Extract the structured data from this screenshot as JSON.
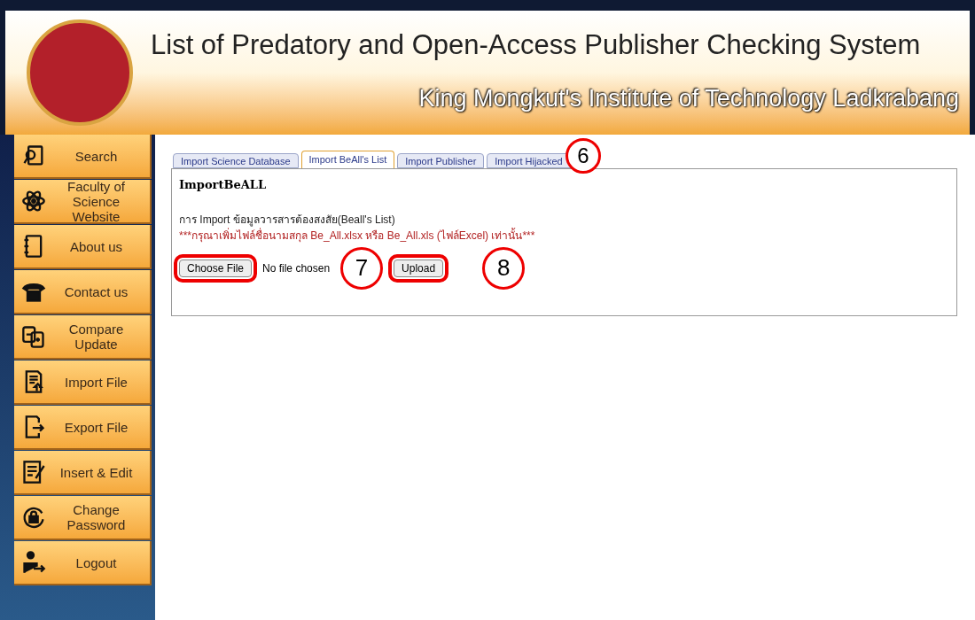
{
  "header": {
    "title": "List of Predatory and Open-Access Publisher Checking System",
    "subtitle": "King Mongkut's Institute of Technology Ladkrabang"
  },
  "sidebar": {
    "items": [
      {
        "label": "Search",
        "kind": "search"
      },
      {
        "label": "Faculty of Science Website",
        "kind": "atom"
      },
      {
        "label": "About us",
        "kind": "notebook"
      },
      {
        "label": "Contact us",
        "kind": "phone"
      },
      {
        "label": "Compare Update",
        "kind": "compare"
      },
      {
        "label": "Import File",
        "kind": "import"
      },
      {
        "label": "Export File",
        "kind": "export"
      },
      {
        "label": "Insert & Edit",
        "kind": "edit"
      },
      {
        "label": "Change Password",
        "kind": "lock"
      },
      {
        "label": "Logout",
        "kind": "logout"
      }
    ]
  },
  "tabs": [
    {
      "label": "Import Science Database",
      "selected": false
    },
    {
      "label": "Import BeAll's List",
      "selected": true
    },
    {
      "label": "Import Publisher",
      "selected": false
    },
    {
      "label": "Import Hijacked",
      "selected": false
    }
  ],
  "panel": {
    "heading": "ImportBeALL",
    "description": "การ Import ข้อมูลวารสารต้องสงสัย(Beall's List)",
    "warning": "***กรุณาเพิ่มไฟล์ชื่อนามสกุล Be_All.xlsx หรือ Be_All.xls (ไฟล์Excel) เท่านั้น***",
    "file_button": "Choose File",
    "file_status": "No file chosen",
    "upload_button": "Upload"
  },
  "callouts": [
    "6",
    "7",
    "8"
  ]
}
